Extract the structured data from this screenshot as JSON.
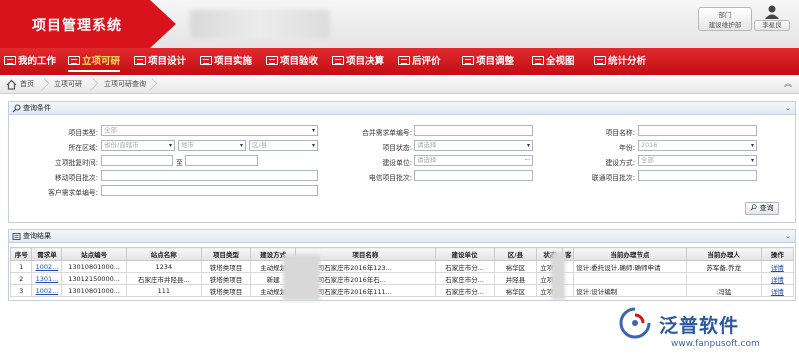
{
  "app": {
    "title": "项目管理系统"
  },
  "header": {
    "dept_line1": "部门",
    "dept_line2": "建设维护部",
    "user_name": "李星良"
  },
  "nav": [
    {
      "label": "我的工作",
      "active": false
    },
    {
      "label": "立项可研",
      "active": true
    },
    {
      "label": "项目设计",
      "active": false
    },
    {
      "label": "项目实施",
      "active": false
    },
    {
      "label": "项目验收",
      "active": false
    },
    {
      "label": "项目决算",
      "active": false
    },
    {
      "label": "后评价",
      "active": false
    },
    {
      "label": "项目调整",
      "active": false
    },
    {
      "label": "全视图",
      "active": false
    },
    {
      "label": "统计分析",
      "active": false
    }
  ],
  "breadcrumb": [
    "首页",
    "立项可研",
    "立项可研查询"
  ],
  "query": {
    "title": "查询条件",
    "project_type_label": "项目类型:",
    "project_type_value": "全部",
    "region_label": "所在区域:",
    "province_placeholder": "省份/直辖市",
    "city_placeholder": "地市",
    "district_placeholder": "区/县",
    "approve_time_label": "立项批复时间:",
    "approve_to": "至",
    "mobile_batch_label": "移动项目批次:",
    "customer_req_label": "客户需求单编号:",
    "merge_req_label": "合并需求单编号:",
    "status_label": "项目状态:",
    "status_placeholder": "请选择",
    "build_unit_label": "建设单位:",
    "build_unit_placeholder": "请选择",
    "telecom_batch_label": "电信项目批次:",
    "project_name_label": "项目名称:",
    "year_label": "年份:",
    "year_value": "2016",
    "build_mode_label": "建设方式:",
    "build_mode_value": "全部",
    "unicom_batch_label": "联通项目批次:",
    "search_button": "查询"
  },
  "results": {
    "title": "查询结果",
    "columns": [
      "序号",
      "需求单",
      "站点编号",
      "站点名称",
      "项目类型",
      "建设方式",
      "项目名称",
      "建设单位",
      "区/县",
      "状态",
      "客",
      "当前办理节点",
      "当前办理人",
      "操作"
    ],
    "rows": [
      [
        "1",
        "1002...",
        "13010801000...",
        "1234",
        "铁塔类项目",
        "主动规划",
        "化分公司石家庄市2016年123...",
        "石家庄市分...",
        "裕华区",
        "立项...",
        "",
        "设计:委托设计,确师:确师申请",
        "苏军备,乔龙",
        "详情"
      ],
      [
        "2",
        "1301...",
        "13012150000...",
        "石家庄市井陉县...",
        "铁塔类项目",
        "新建",
        "化分公司石家庄市2016年石...",
        "石家庄市分...",
        "井陉县",
        "立项...",
        "",
        "",
        "",
        "详情"
      ],
      [
        "3",
        "1002...",
        "13010801000...",
        "111",
        "铁塔类项目",
        "主动规划",
        "化分公司石家庄市2016年111...",
        "石家庄市分...",
        "裕华区",
        "立项...",
        "",
        "设计:设计编制",
        ":冯猛",
        "详情"
      ]
    ]
  },
  "watermark": {
    "brand": "泛普软件",
    "url": "www.fanpusoft.com"
  },
  "colors": {
    "brand_red": "#d8131b",
    "nav_active": "#ffe35c",
    "link_blue": "#1a4fb5"
  }
}
